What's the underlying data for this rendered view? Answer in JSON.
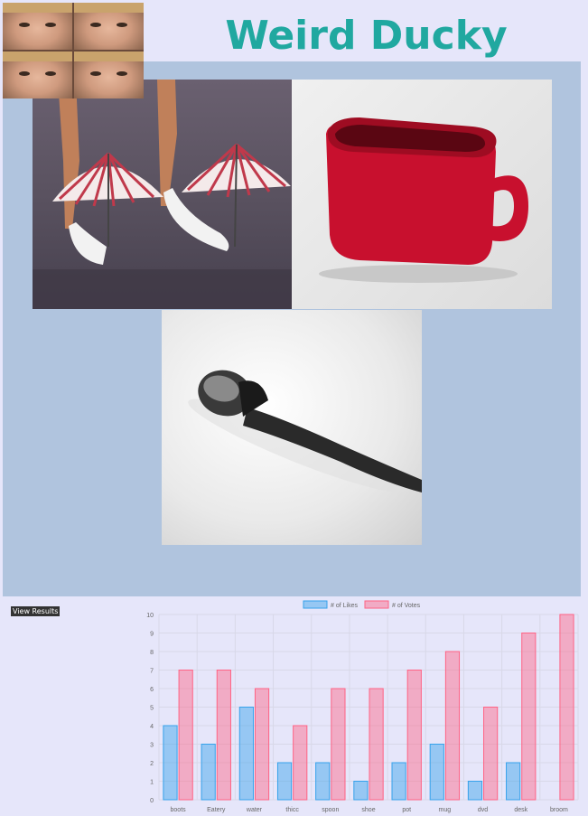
{
  "page": {
    "title": "Weird Ducky"
  },
  "logo": {
    "icon": "four-face-collage-icon"
  },
  "products": [
    {
      "name": "boots",
      "icon": "umbrella-boots-image"
    },
    {
      "name": "mug",
      "icon": "red-mug-image"
    },
    {
      "name": "spoon",
      "icon": "spoon-image"
    }
  ],
  "controls": {
    "view_results_label": "View Results"
  },
  "colors": {
    "title": "#20a8a0",
    "gallery_bg": "#b0c4de",
    "page_bg": "#e6e6fa",
    "likes": "#36a2eb",
    "votes": "#ff6384"
  },
  "chart_data": {
    "type": "bar",
    "categories": [
      "boots",
      "Eatery",
      "water",
      "thicc",
      "spoon",
      "shoe",
      "pot",
      "mug",
      "dvd",
      "desk",
      "broom"
    ],
    "series": [
      {
        "name": "# of Likes",
        "values": [
          4,
          3,
          5,
          2,
          2,
          1,
          2,
          3,
          1,
          2,
          0
        ]
      },
      {
        "name": "# of Votes",
        "values": [
          7,
          7,
          6,
          4,
          6,
          6,
          7,
          8,
          5,
          9,
          10
        ]
      }
    ],
    "ylim": [
      0,
      10
    ],
    "yticks": [
      "0",
      "1",
      "2",
      "3",
      "4",
      "5",
      "6",
      "7",
      "8",
      "9",
      "10"
    ],
    "grid": true,
    "legend": "top"
  }
}
